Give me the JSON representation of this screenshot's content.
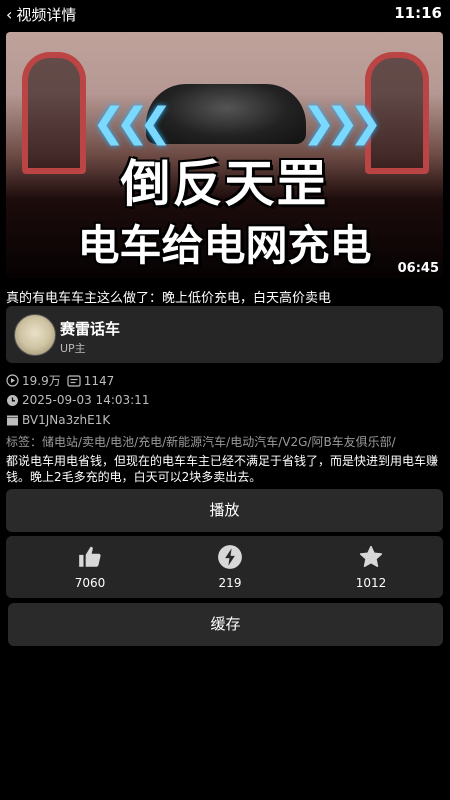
{
  "header": {
    "back_label": "视频详情",
    "time": "11:16"
  },
  "video": {
    "cover_line1": "倒反天罡",
    "cover_line2": "电车给电网充电",
    "duration": "06:45",
    "title": "真的有电车车主这么做了：晚上低价充电，白天高价卖电"
  },
  "uploader": {
    "name": "赛雷话车",
    "role": "UP主"
  },
  "stats": {
    "views": "19.9万",
    "danmaku": "1147",
    "date": "2025-09-03 14:03:11",
    "bvid": "BV1JNa3zhE1K"
  },
  "tags": "标签：储电站/卖电/电池/充电/新能源汽车/电动汽车/V2G/阿B车友俱乐部/",
  "description": "都说电车用电省钱，但现在的电车车主已经不满足于省钱了，而是快进到用电车赚钱。晚上2毛多充的电，白天可以2块多卖出去。",
  "buttons": {
    "play": "播放",
    "cache": "缓存"
  },
  "actions": {
    "like": "7060",
    "coin": "219",
    "favorite": "1012"
  }
}
